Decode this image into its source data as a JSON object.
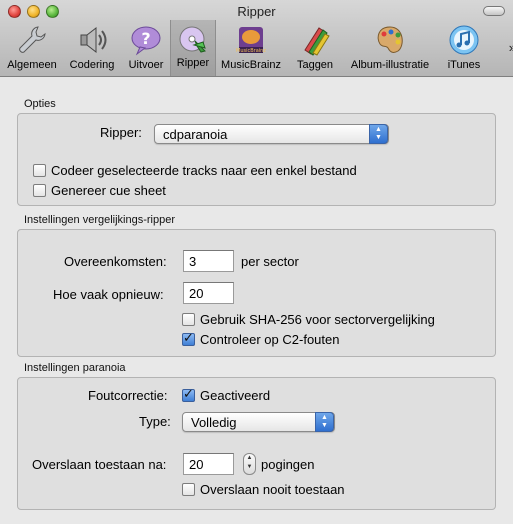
{
  "window": {
    "title": "Ripper"
  },
  "toolbar": {
    "items": [
      {
        "label": "Algemeen",
        "icon": "wrench-icon"
      },
      {
        "label": "Codering",
        "icon": "speaker-icon"
      },
      {
        "label": "Uitvoer",
        "icon": "question-bubble-icon"
      },
      {
        "label": "Ripper",
        "icon": "cd-ripper-icon"
      },
      {
        "label": "MusicBrainz",
        "icon": "musicbrainz-icon"
      },
      {
        "label": "Taggen",
        "icon": "crayons-icon"
      },
      {
        "label": "Album-illustratie",
        "icon": "palette-icon"
      },
      {
        "label": "iTunes",
        "icon": "itunes-icon"
      }
    ],
    "more_glyph": "»",
    "selected": "Ripper"
  },
  "opties": {
    "title": "Opties",
    "ripper_label": "Ripper:",
    "ripper_value": "cdparanoia",
    "encode_single_label": "Codeer geselecteerde tracks naar een enkel bestand",
    "encode_single_checked": false,
    "cue_sheet_label": "Genereer cue sheet",
    "cue_sheet_checked": false
  },
  "comparison": {
    "title": "Instellingen vergelijkings-ripper",
    "matches_label": "Overeenkomsten:",
    "matches_value": "3",
    "matches_unit": "per sector",
    "retries_label": "Hoe vaak opnieuw:",
    "retries_value": "20",
    "sha_label": "Gebruik SHA-256 voor sectorvergelijking",
    "sha_checked": false,
    "c2_label": "Controleer op C2-fouten",
    "c2_checked": true
  },
  "paranoia": {
    "title": "Instellingen paranoia",
    "correction_label": "Foutcorrectie:",
    "correction_value_label": "Geactiveerd",
    "correction_checked": true,
    "type_label": "Type:",
    "type_value": "Volledig",
    "skip_label": "Overslaan toestaan na:",
    "skip_value": "20",
    "skip_unit": "pogingen",
    "never_skip_label": "Overslaan nooit toestaan",
    "never_skip_checked": false
  },
  "colors": {
    "accent": "#3f7fd5",
    "group_bg": "#dfdfdf",
    "window_bg": "#e8e8e8"
  }
}
